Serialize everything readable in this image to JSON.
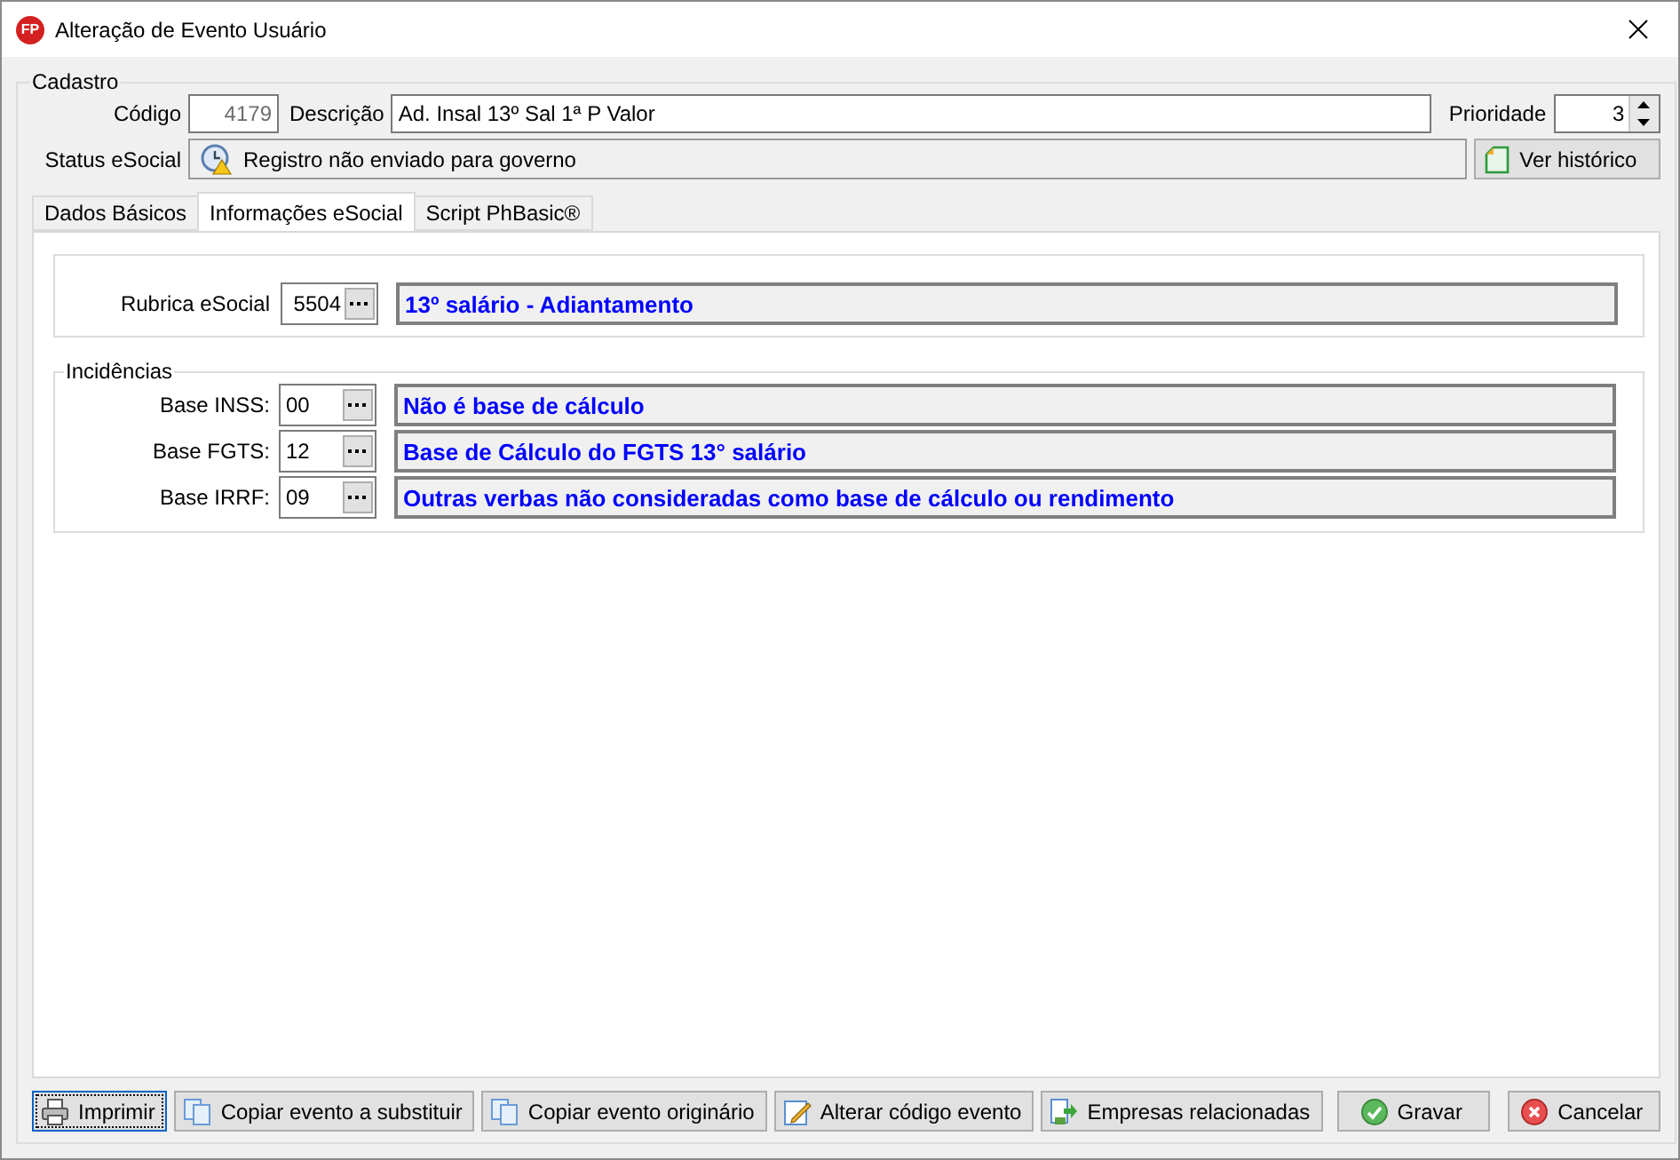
{
  "window": {
    "title": "Alteração de Evento Usuário",
    "logo": "FP"
  },
  "cadastro": {
    "legend": "Cadastro",
    "codigo": {
      "label": "Código",
      "value": "4179"
    },
    "descricao": {
      "label": "Descrição",
      "value": "Ad. Insal 13º Sal 1ª P Valor"
    },
    "prioridade": {
      "label": "Prioridade",
      "value": "3"
    },
    "status": {
      "label": "Status eSocial",
      "value": "Registro não enviado para governo"
    },
    "history_button": "Ver histórico"
  },
  "tabs": [
    {
      "label": "Dados Básicos",
      "selected": false
    },
    {
      "label": "Informações eSocial",
      "selected": true
    },
    {
      "label": "Script PhBasic®",
      "selected": false
    }
  ],
  "rubrica": {
    "label": "Rubrica eSocial",
    "code": "5504",
    "description": "13º salário - Adiantamento"
  },
  "incidencias": {
    "legend": "Incidências",
    "rows": [
      {
        "label": "Base INSS:",
        "code": "00",
        "description": "Não é base de cálculo"
      },
      {
        "label": "Base FGTS:",
        "code": "12",
        "description": "Base de Cálculo do FGTS 13° salário"
      },
      {
        "label": "Base IRRF:",
        "code": "09",
        "description": "Outras verbas não consideradas como base de cálculo ou rendimento"
      }
    ]
  },
  "buttons": [
    {
      "label": "Imprimir",
      "kind": "action",
      "focused": true
    },
    {
      "label": "Copiar evento a substituir",
      "kind": "action",
      "focused": false
    },
    {
      "label": "Copiar evento originário",
      "kind": "action",
      "focused": false
    },
    {
      "label": "Alterar código evento",
      "kind": "action",
      "focused": false
    },
    {
      "label": "Empresas relacionadas",
      "kind": "action",
      "focused": false
    },
    {
      "label": "Gravar",
      "kind": "dialog",
      "focused": false
    },
    {
      "label": "Cancelar",
      "kind": "dialog",
      "focused": false
    }
  ]
}
